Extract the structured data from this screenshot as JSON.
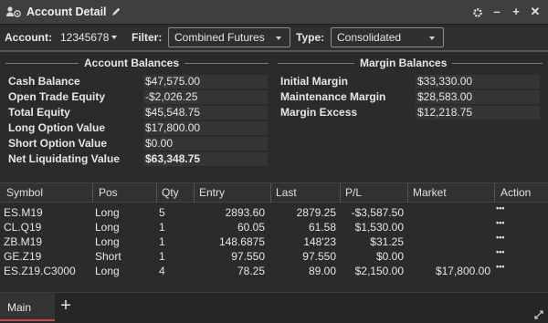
{
  "window": {
    "title": "Account Detail",
    "buttons": [
      "gear-icon",
      "minimize-icon",
      "add-icon",
      "close-icon"
    ]
  },
  "toolbar": {
    "account_label": "Account:",
    "account_value": "12345678",
    "filter_label": "Filter:",
    "filter_value": "Combined Futures",
    "type_label": "Type:",
    "type_value": "Consolidated"
  },
  "account_balances": {
    "title": "Account Balances",
    "rows": [
      {
        "label": "Cash Balance",
        "value": "$47,575.00"
      },
      {
        "label": "Open Trade Equity",
        "value": "-$2,026.25"
      },
      {
        "label": "Total Equity",
        "value": "$45,548.75"
      },
      {
        "label": "Long Option Value",
        "value": "$17,800.00"
      },
      {
        "label": "Short Option Value",
        "value": "$0.00"
      },
      {
        "label": "Net Liquidating Value",
        "value": "$63,348.75"
      }
    ]
  },
  "margin_balances": {
    "title": "Margin Balances",
    "rows": [
      {
        "label": "Initial Margin",
        "value": "$33,330.00"
      },
      {
        "label": "Maintenance Margin",
        "value": "$28,583.00"
      },
      {
        "label": "Margin Excess",
        "value": "$12,218.75"
      }
    ]
  },
  "positions": {
    "columns": [
      "Symbol",
      "Pos",
      "Qty",
      "Entry",
      "Last",
      "P/L",
      "Market",
      "Action"
    ],
    "rows": [
      {
        "symbol": "ES.M19",
        "pos": "Long",
        "qty": "5",
        "entry": "2893.60",
        "last": "2879.25",
        "pl": "-$3,587.50",
        "market": "",
        "action": "•••"
      },
      {
        "symbol": "CL.Q19",
        "pos": "Long",
        "qty": "1",
        "entry": "60.05",
        "last": "61.58",
        "pl": "$1,530.00",
        "market": "",
        "action": "•••"
      },
      {
        "symbol": "ZB.M19",
        "pos": "Long",
        "qty": "1",
        "entry": "148.6875",
        "last": "148'23",
        "pl": "$31.25",
        "market": "",
        "action": "•••"
      },
      {
        "symbol": "GE.Z19",
        "pos": "Short",
        "qty": "1",
        "entry": "97.550",
        "last": "97.550",
        "pl": "$0.00",
        "market": "",
        "action": "•••"
      },
      {
        "symbol": "ES.Z19.C3000",
        "pos": "Long",
        "qty": "4",
        "entry": "78.25",
        "last": "89.00",
        "pl": "$2,150.00",
        "market": "$17,800.00",
        "action": "•••"
      }
    ]
  },
  "tabs": {
    "main_label": "Main",
    "add_label": "+"
  }
}
